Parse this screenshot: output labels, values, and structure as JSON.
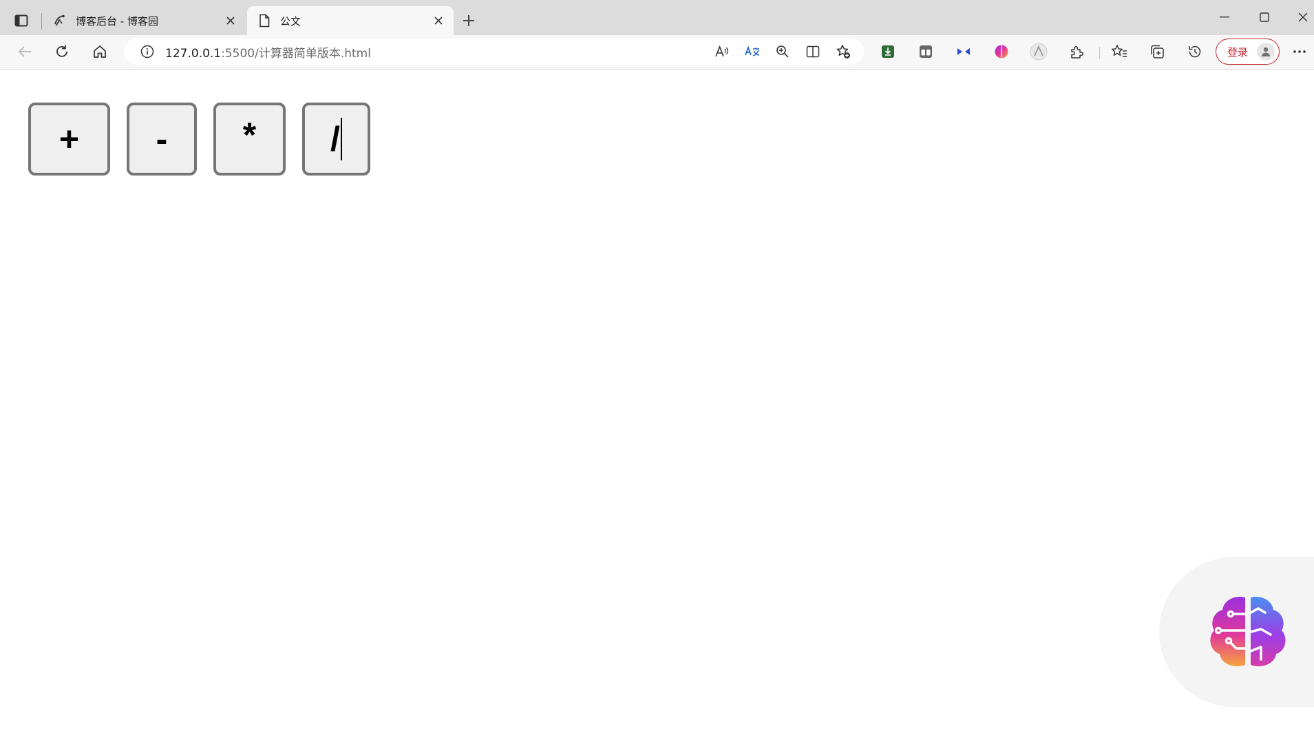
{
  "tabs": [
    {
      "title": "博客后台 - 博客园",
      "active": false
    },
    {
      "title": "公文",
      "active": true
    }
  ],
  "address": {
    "host": "127.0.0.1",
    "rest": ":5500/计算器简单版本.html"
  },
  "toolbar": {
    "login_label": "登录"
  },
  "calculator": {
    "buttons": [
      "+",
      "-",
      "*",
      "/"
    ]
  },
  "colors": {
    "tab_bg": "#dcdcdc",
    "toolbar_bg": "#f7f7f7",
    "login_accent": "#c2272d",
    "button_border": "#767676",
    "button_bg": "#efefef"
  }
}
